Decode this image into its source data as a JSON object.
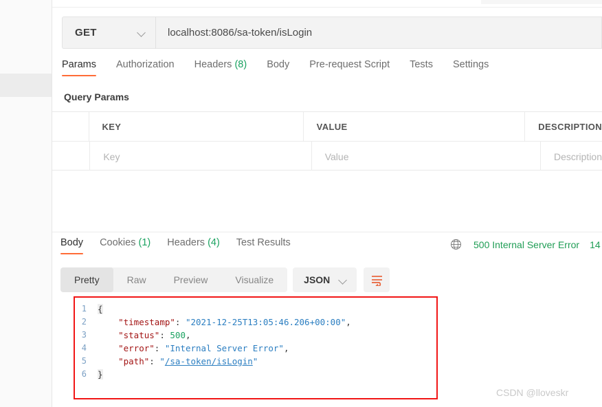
{
  "request": {
    "method": "GET",
    "method_chevron": "chevron-down-icon",
    "url": "localhost:8086/sa-token/isLogin",
    "tabs": [
      {
        "label": "Params",
        "count": "",
        "active": true
      },
      {
        "label": "Authorization",
        "count": "",
        "active": false
      },
      {
        "label": "Headers",
        "count": "(8)",
        "active": false
      },
      {
        "label": "Body",
        "count": "",
        "active": false
      },
      {
        "label": "Pre-request Script",
        "count": "",
        "active": false
      },
      {
        "label": "Tests",
        "count": "",
        "active": false
      },
      {
        "label": "Settings",
        "count": "",
        "active": false
      }
    ],
    "query_params_title": "Query Params",
    "table": {
      "headers": [
        "KEY",
        "VALUE",
        "DESCRIPTION"
      ],
      "placeholder_row": [
        "Key",
        "Value",
        "Description"
      ]
    }
  },
  "response": {
    "tabs": [
      {
        "label": "Body",
        "count": "",
        "active": true
      },
      {
        "label": "Cookies",
        "count": "(1)",
        "active": false
      },
      {
        "label": "Headers",
        "count": "(4)",
        "active": false
      },
      {
        "label": "Test Results",
        "count": "",
        "active": false
      }
    ],
    "status": {
      "icon": "globe-icon",
      "text": "500 Internal Server Error",
      "time": "14",
      "color": "#1f9d55"
    },
    "view_modes": [
      {
        "label": "Pretty",
        "active": true
      },
      {
        "label": "Raw",
        "active": false
      },
      {
        "label": "Preview",
        "active": false
      },
      {
        "label": "Visualize",
        "active": false
      }
    ],
    "format": {
      "label": "JSON",
      "chevron": "chevron-down-icon"
    },
    "wrap_button": "wrap-text-icon",
    "body_lines": [
      {
        "no": "1",
        "segments": [
          {
            "t": "{",
            "c": "brace"
          }
        ]
      },
      {
        "no": "2",
        "segments": [
          {
            "t": "    ",
            "c": "p"
          },
          {
            "t": "\"timestamp\"",
            "c": "k"
          },
          {
            "t": ": ",
            "c": "p"
          },
          {
            "t": "\"2021-12-25T13:05:46.206+00:00\"",
            "c": "s"
          },
          {
            "t": ",",
            "c": "p"
          }
        ]
      },
      {
        "no": "3",
        "segments": [
          {
            "t": "    ",
            "c": "p"
          },
          {
            "t": "\"status\"",
            "c": "k"
          },
          {
            "t": ": ",
            "c": "p"
          },
          {
            "t": "500",
            "c": "n"
          },
          {
            "t": ",",
            "c": "p"
          }
        ]
      },
      {
        "no": "4",
        "segments": [
          {
            "t": "    ",
            "c": "p"
          },
          {
            "t": "\"error\"",
            "c": "k"
          },
          {
            "t": ": ",
            "c": "p"
          },
          {
            "t": "\"Internal Server Error\"",
            "c": "s"
          },
          {
            "t": ",",
            "c": "p"
          }
        ]
      },
      {
        "no": "5",
        "segments": [
          {
            "t": "    ",
            "c": "p"
          },
          {
            "t": "\"path\"",
            "c": "k"
          },
          {
            "t": ": ",
            "c": "p"
          },
          {
            "t": "\"",
            "c": "s"
          },
          {
            "t": "/sa-token/isLogin",
            "c": "u"
          },
          {
            "t": "\"",
            "c": "s"
          }
        ]
      },
      {
        "no": "6",
        "segments": [
          {
            "t": "}",
            "c": "brace"
          }
        ]
      }
    ],
    "highlight_color": "#f11515"
  },
  "watermark": "CSDN @lloveskr"
}
